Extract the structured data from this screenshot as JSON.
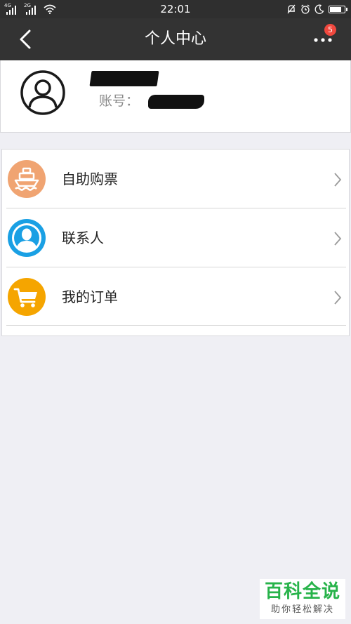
{
  "status_bar": {
    "network1": "4G",
    "network2": "2G",
    "time": "22:01",
    "battery_level": 0.85
  },
  "nav": {
    "title": "个人中心",
    "badge_count": "5"
  },
  "profile": {
    "account_label": "账号："
  },
  "menu": {
    "items": [
      {
        "label": "自助购票",
        "icon": "ship-icon",
        "color": "#f0a472"
      },
      {
        "label": "联系人",
        "icon": "contact-icon",
        "color": "#1aa0e4"
      },
      {
        "label": "我的订单",
        "icon": "cart-icon",
        "color": "#f5a500"
      }
    ]
  },
  "watermark": {
    "main": "百科全说",
    "sub": "助你轻松解决"
  }
}
